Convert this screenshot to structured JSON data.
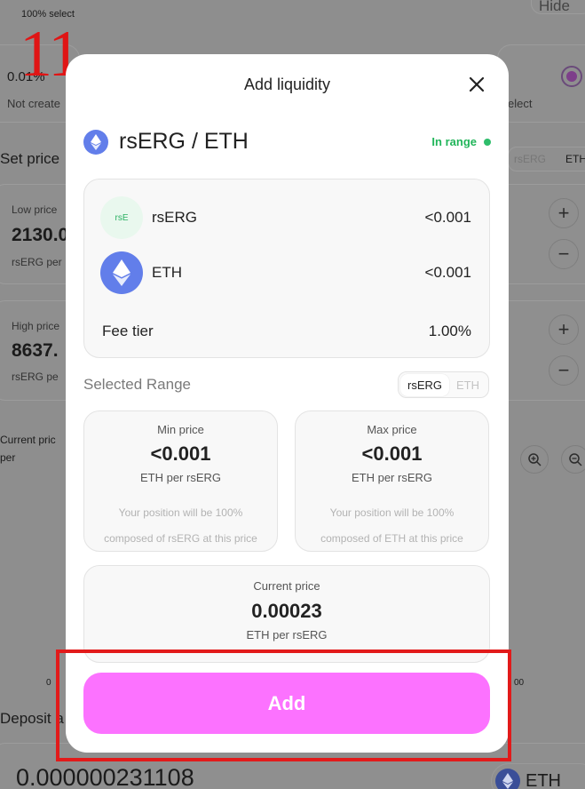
{
  "background": {
    "select_caption": "100% select",
    "hide_label": "Hide",
    "fee_option": "0.01%",
    "not_created": "Not create",
    "select_right": "elect",
    "set_price": "Set price",
    "toggle_rs": "rsERG",
    "toggle_eth": "ETH",
    "low_label": "Low price",
    "low_value": "2130.0",
    "low_unit": "rsERG per",
    "high_label": "High price",
    "high_value": "8637.",
    "high_unit": "rsERG pe",
    "current_label": "Current pric",
    "current_unit": "per",
    "axis_left": "0",
    "axis_right": "00",
    "deposit_label": "Deposit a",
    "deposit_amount": "0.000000231108",
    "deposit_token": "ETH",
    "plus": "+",
    "minus": "−"
  },
  "step_number": "11",
  "modal": {
    "title": "Add liquidity",
    "pair": "rsERG / ETH",
    "status": "In range",
    "tokens": [
      {
        "icon_text": "rsE",
        "name": "rsERG",
        "amount": "<0.001"
      },
      {
        "icon_text": "",
        "name": "ETH",
        "amount": "<0.001"
      }
    ],
    "fee_tier_label": "Fee tier",
    "fee_tier_value": "1.00%",
    "selected_range_label": "Selected Range",
    "range_toggle": {
      "active": "rsERG",
      "inactive": "ETH"
    },
    "min_price": {
      "label": "Min price",
      "value": "<0.001",
      "unit": "ETH per rsERG",
      "note_line1": "Your position will be 100%",
      "note_line2": "composed of rsERG at this price"
    },
    "max_price": {
      "label": "Max price",
      "value": "<0.001",
      "unit": "ETH per rsERG",
      "note_line1": "Your position will be 100%",
      "note_line2": "composed of ETH at this price"
    },
    "current_price": {
      "label": "Current price",
      "value": "0.00023",
      "unit": "ETH per rsERG"
    },
    "add_button": "Add"
  },
  "colors": {
    "accent_pink": "#fc72ff",
    "in_range_green": "#21b55a",
    "eth_blue": "#627eea",
    "highlight_red": "#e21a1a"
  },
  "icons": [
    "close-icon",
    "eth-icon",
    "rserg-icon",
    "zoom-in-icon",
    "zoom-out-icon"
  ]
}
